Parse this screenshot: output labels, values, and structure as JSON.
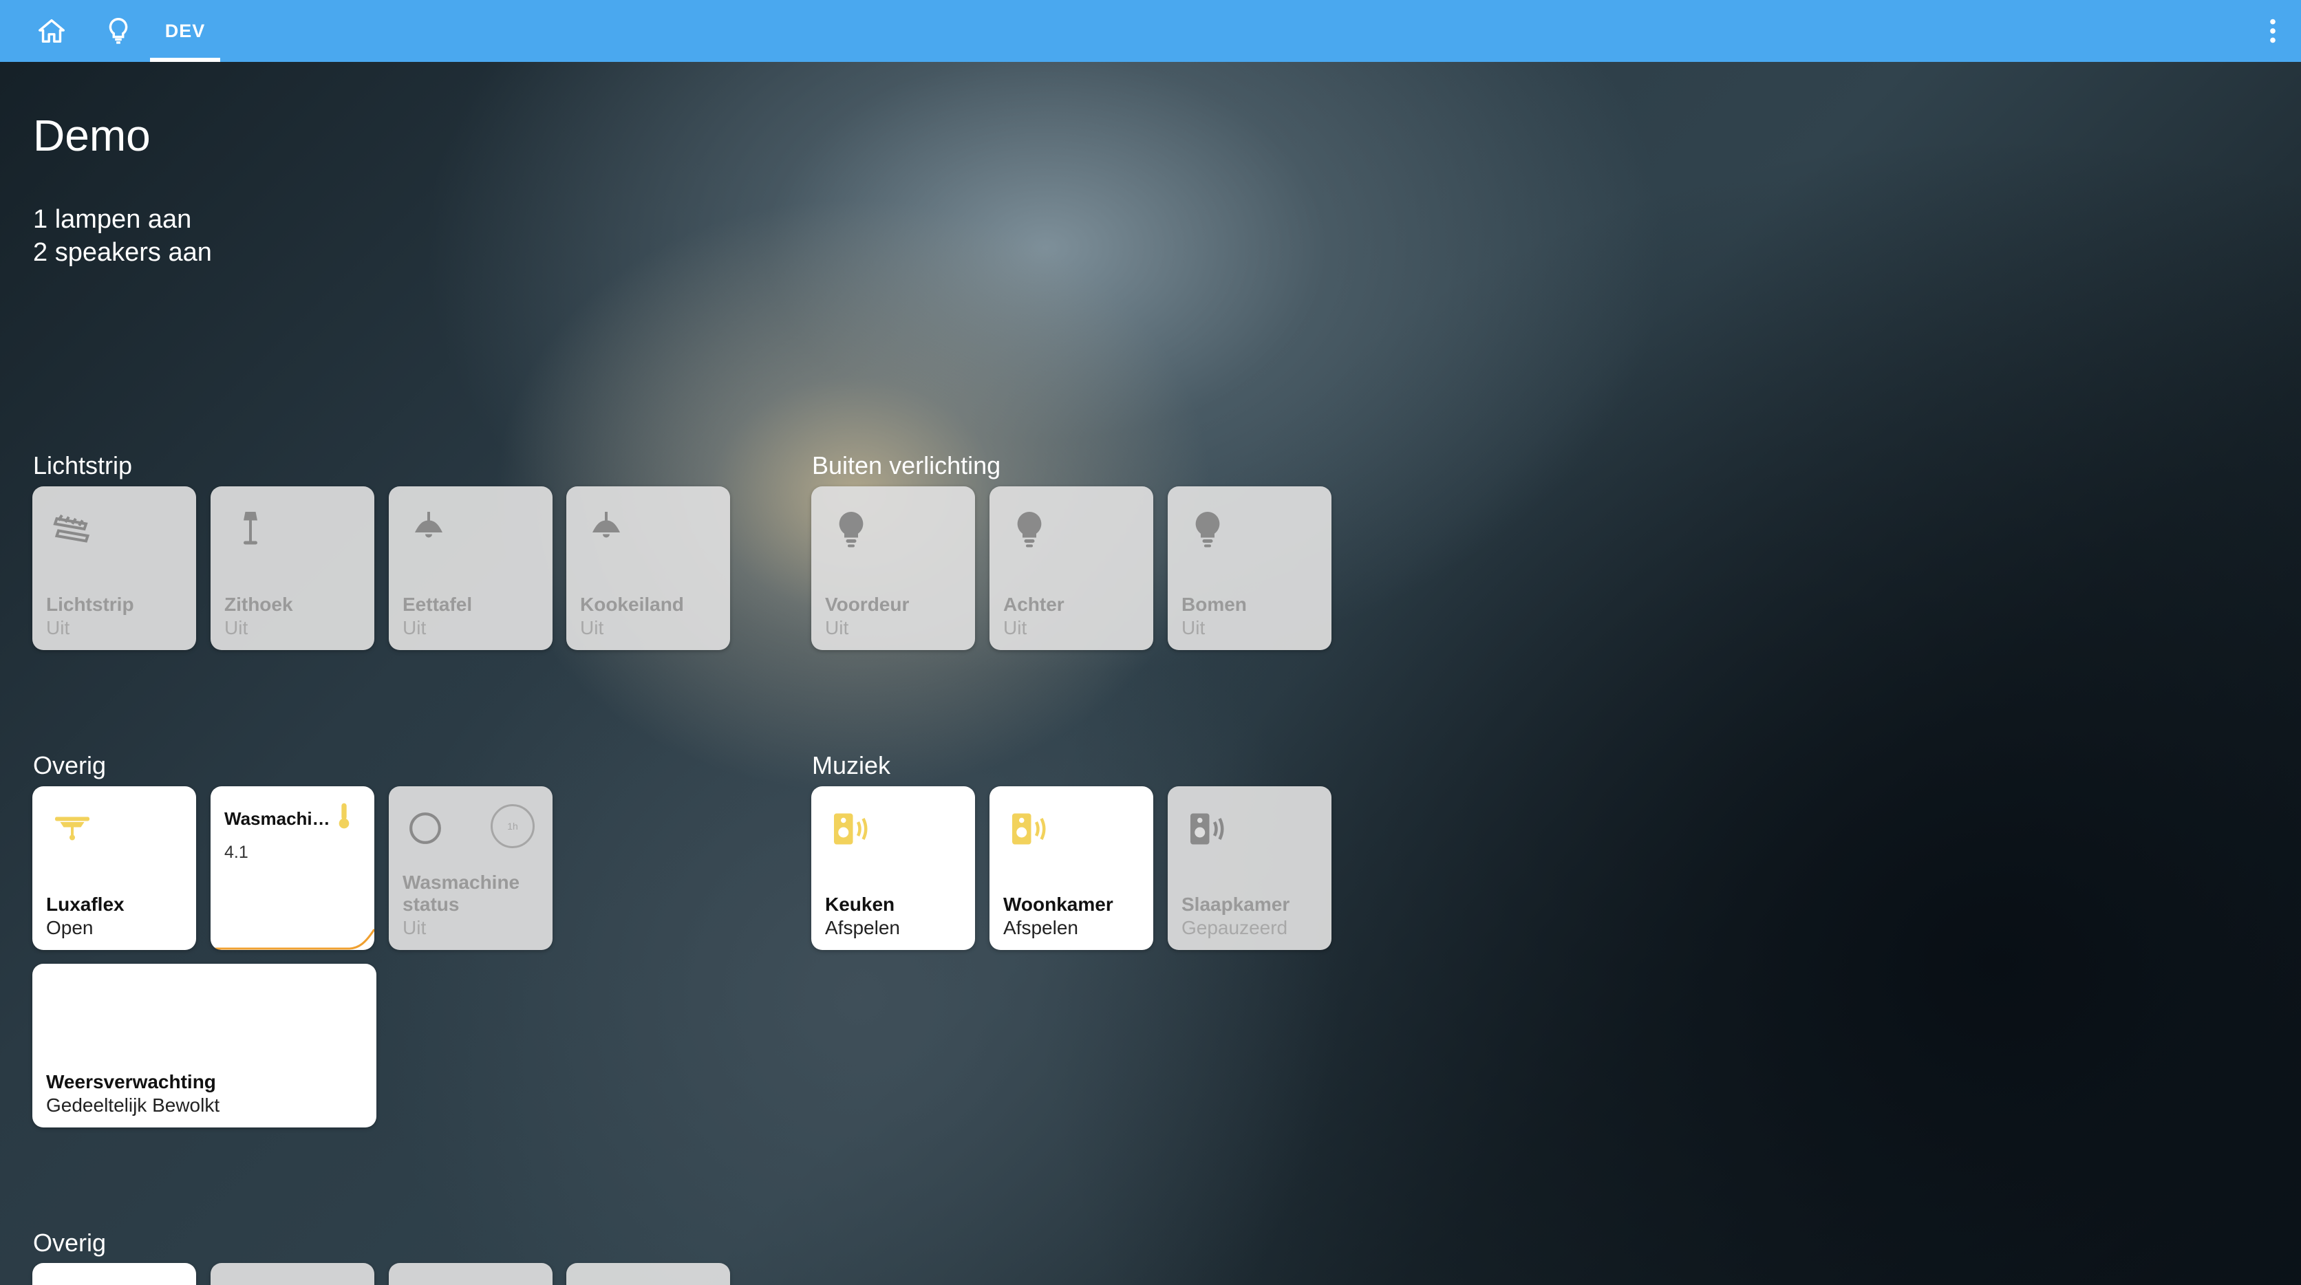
{
  "topbar": {
    "home_icon": "home-icon",
    "light_icon": "lightbulb-icon",
    "tab_dev_label": "DEV",
    "menu_icon": "dots-vertical-icon",
    "color": "#4aa8ef"
  },
  "page": {
    "title": "Demo",
    "summary_lamps": "1 lampen aan",
    "summary_speakers": "2 speakers aan"
  },
  "sections": {
    "lichtstrip": {
      "title": "Lichtstrip",
      "tiles": [
        {
          "name": "Lichtstrip",
          "state": "Uit",
          "icon": "led-strip-icon"
        },
        {
          "name": "Zithoek",
          "state": "Uit",
          "icon": "floor-lamp-icon"
        },
        {
          "name": "Eettafel",
          "state": "Uit",
          "icon": "ceiling-light-icon"
        },
        {
          "name": "Kookeiland",
          "state": "Uit",
          "icon": "ceiling-light-icon"
        }
      ]
    },
    "buiten": {
      "title": "Buiten verlichting",
      "tiles": [
        {
          "name": "Voordeur",
          "state": "Uit",
          "icon": "lightbulb-icon"
        },
        {
          "name": "Achter",
          "state": "Uit",
          "icon": "lightbulb-icon"
        },
        {
          "name": "Bomen",
          "state": "Uit",
          "icon": "lightbulb-icon"
        }
      ]
    },
    "overig": {
      "title": "Overig",
      "tiles": [
        {
          "name": "Luxaflex",
          "state": "Open",
          "icon": "blinds-icon"
        },
        {
          "name": "Wasmachi…",
          "value": "4.1",
          "icon": "thermometer-icon"
        },
        {
          "name": "Wasmachine status",
          "name_line1": "Wasmachine",
          "name_line2": "status",
          "state": "Uit",
          "icon": "circle-outline-icon",
          "badge": "1h"
        },
        {
          "name": "Weersverwachting",
          "state": "Gedeeltelijk Bewolkt"
        }
      ]
    },
    "muziek": {
      "title": "Muziek",
      "tiles": [
        {
          "name": "Keuken",
          "state": "Afspelen",
          "icon": "speaker-wireless-icon"
        },
        {
          "name": "Woonkamer",
          "state": "Afspelen",
          "icon": "speaker-wireless-icon"
        },
        {
          "name": "Slaapkamer",
          "state": "Gepauzeerd",
          "icon": "speaker-wireless-icon"
        }
      ]
    },
    "overig2": {
      "title": "Overig"
    }
  },
  "colors": {
    "active_yellow": "#f2d25c",
    "inactive_icon": "#8a8a8a",
    "sparkline": "#f0a030"
  }
}
